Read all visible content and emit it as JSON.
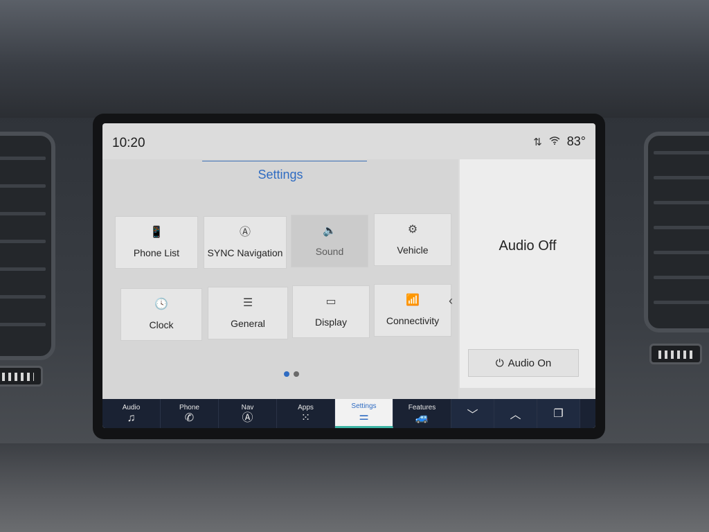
{
  "status": {
    "time": "10:20",
    "temperature": "83°",
    "signal_icon": "signal-arrows-icon",
    "wifi_icon": "wifi-icon"
  },
  "settings": {
    "title": "Settings",
    "tiles": [
      {
        "label": "Phone List",
        "icon": "📱"
      },
      {
        "label": "SYNC Navigation",
        "icon": "Ⓐ"
      },
      {
        "label": "Sound",
        "icon": "🔈"
      },
      {
        "label": "Vehicle",
        "icon": "⚙"
      },
      {
        "label": "Clock",
        "icon": "🕓"
      },
      {
        "label": "General",
        "icon": "☰"
      },
      {
        "label": "Display",
        "icon": "▭"
      },
      {
        "label": "Connectivity",
        "icon": "📶"
      }
    ],
    "pages_total": 2,
    "current_page": 1,
    "collapse_icon": "‹"
  },
  "audio": {
    "status": "Audio Off",
    "on_button": "Audio On",
    "power_icon": "⏻"
  },
  "nav": {
    "items": [
      {
        "label": "Audio",
        "icon": "♫"
      },
      {
        "label": "Phone",
        "icon": "✆"
      },
      {
        "label": "Nav",
        "icon": "Ⓐ"
      },
      {
        "label": "Apps",
        "icon": "⁙"
      },
      {
        "label": "Settings",
        "icon": "⚌"
      },
      {
        "label": "Features",
        "icon": "🚙"
      }
    ],
    "active": "Settings",
    "down_icon": "﹀",
    "up_icon": "︿",
    "multitask_icon": "❐"
  },
  "colors": {
    "accent": "#2f6cc2",
    "nav_background": "#1a2233",
    "active_underline": "#3db5a5"
  }
}
